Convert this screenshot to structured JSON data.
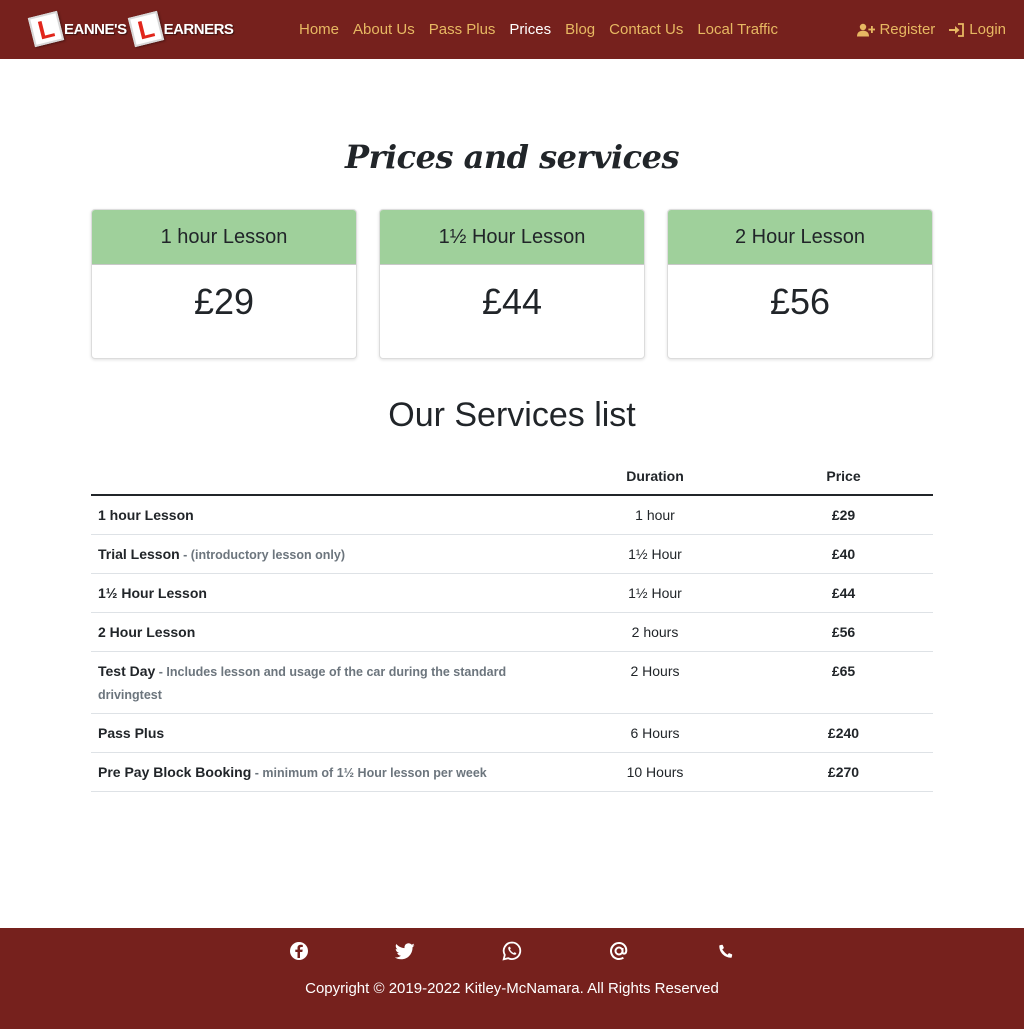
{
  "brand": {
    "plate_letter": "L",
    "word1": "EANNE'S",
    "word2": "EARNERS"
  },
  "nav": {
    "links": [
      "Home",
      "About Us",
      "Pass Plus",
      "Prices",
      "Blog",
      "Contact Us",
      "Local Traffic"
    ],
    "active": "Prices",
    "register": "Register",
    "login": "Login"
  },
  "main": {
    "title": "Prices and services",
    "cards": [
      {
        "title": "1 hour Lesson",
        "price": "£29"
      },
      {
        "title": "1½ Hour Lesson",
        "price": "£44"
      },
      {
        "title": "2 Hour Lesson",
        "price": "£56"
      }
    ],
    "services_title": "Our Services list",
    "table": {
      "headers": [
        "",
        "Duration",
        "Price"
      ],
      "rows": [
        {
          "name": "1 hour Lesson",
          "note": "",
          "duration": "1 hour",
          "price": "£29"
        },
        {
          "name": "Trial Lesson",
          "note": " - (introductory lesson only)",
          "duration": "1½ Hour",
          "price": "£40"
        },
        {
          "name": "1½ Hour Lesson",
          "note": "",
          "duration": "1½ Hour",
          "price": "£44"
        },
        {
          "name": "2 Hour Lesson",
          "note": "",
          "duration": "2 hours",
          "price": "£56"
        },
        {
          "name": "Test Day",
          "note": " - Includes lesson and usage of the car during the standard drivingtest",
          "duration": "2 Hours",
          "price": "£65"
        },
        {
          "name": "Pass Plus",
          "note": "",
          "duration": "6 Hours",
          "price": "£240"
        },
        {
          "name": "Pre Pay Block Booking",
          "note": " - minimum of 1½ Hour lesson per week",
          "duration": "10 Hours",
          "price": "£270"
        }
      ]
    }
  },
  "footer": {
    "icons": [
      "facebook-icon",
      "twitter-icon",
      "whatsapp-icon",
      "email-at-icon",
      "phone-icon"
    ],
    "copyright": "Copyright © 2019-2022 Kitley-McNamara. All Rights Reserved"
  },
  "colors": {
    "navbar_bg": "#76211d",
    "nav_link": "#e7b862",
    "card_header": "#9fd09b",
    "footer_bg": "#76211d"
  }
}
